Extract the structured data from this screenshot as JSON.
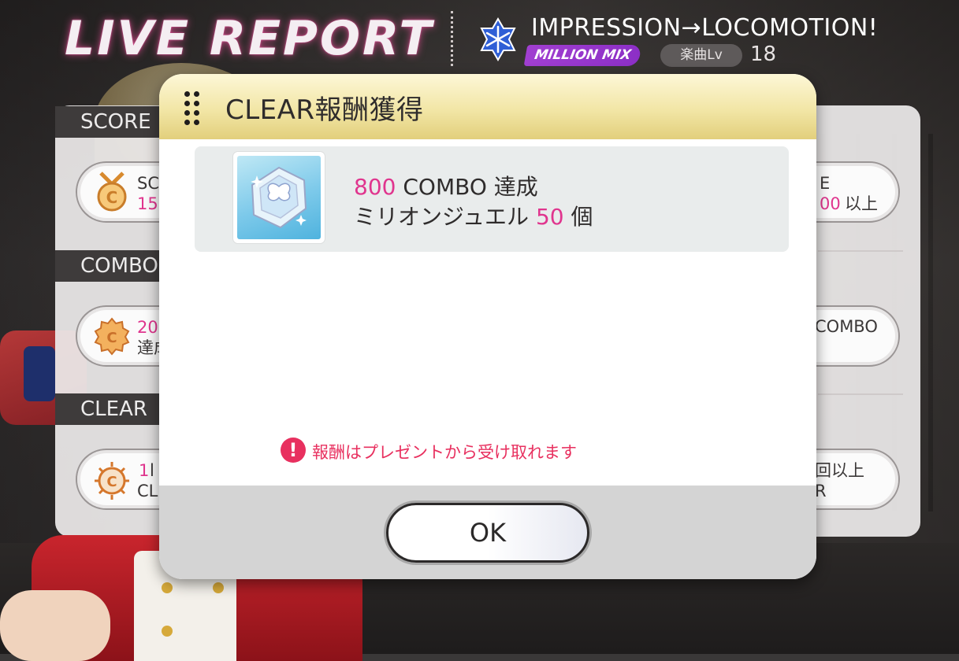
{
  "header": {
    "title": "LIVE REPORT",
    "song_title": "IMPRESSION→LOCOMOTION!",
    "mix_badge": "MILLION MIX",
    "level_label": "楽曲Lv",
    "level_value": "18",
    "song_icon": "snowflake-icon"
  },
  "back_panel": {
    "sections": [
      {
        "label": "SCORE"
      },
      {
        "label": "COMBO"
      },
      {
        "label": "CLEAR"
      }
    ],
    "rows": [
      {
        "left_line1": "SC",
        "left_line2": "15",
        "right_line1": "E",
        "right_line2_pink": "00",
        "right_line2": "以上"
      },
      {
        "left_line1": "20",
        "left_line2": "達成",
        "right_line1": "COMBO"
      },
      {
        "left_line1": "1",
        "left_line1_tail": "l",
        "left_line2": "CL",
        "right_line1": "回以上",
        "right_line2": "R"
      }
    ]
  },
  "modal": {
    "title": "CLEAR報酬獲得",
    "reward": {
      "icon": "million-jewel-icon",
      "combo_value": "800",
      "combo_text": "COMBO 達成",
      "item_name": "ミリオンジュエル",
      "item_count": "50",
      "item_unit": "個"
    },
    "notice": "報酬はプレゼントから受け取れます",
    "ok_label": "OK"
  },
  "colors": {
    "accent_pink": "#e0358e",
    "notice_red": "#e8305f",
    "mix_purple": "#a13fd1",
    "header_gold": "#f2e6a6"
  }
}
